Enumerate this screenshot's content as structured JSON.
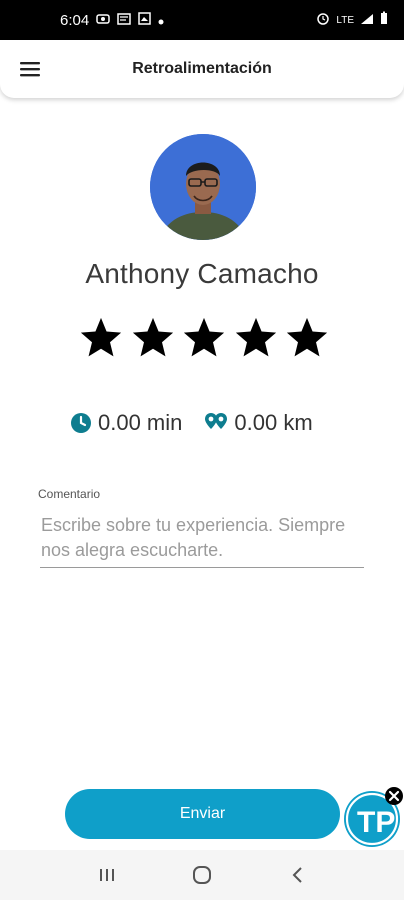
{
  "status_bar": {
    "time": "6:04",
    "network": "LTE"
  },
  "header": {
    "title": "Retroalimentación",
    "menu_icon": "hamburger-menu-icon"
  },
  "profile": {
    "name": "Anthony Camacho",
    "rating": 5,
    "max_rating": 5
  },
  "metrics": {
    "duration": "0.00 min",
    "distance": "0.00 km",
    "accent_color": "#0e7d8f"
  },
  "comment": {
    "label": "Comentario",
    "placeholder": "Escribe sobre tu experiencia. Siempre nos alegra escucharte.",
    "value": ""
  },
  "actions": {
    "send_label": "Enviar",
    "send_color": "#0f9fc9"
  },
  "badge": {
    "letters": "TP"
  }
}
